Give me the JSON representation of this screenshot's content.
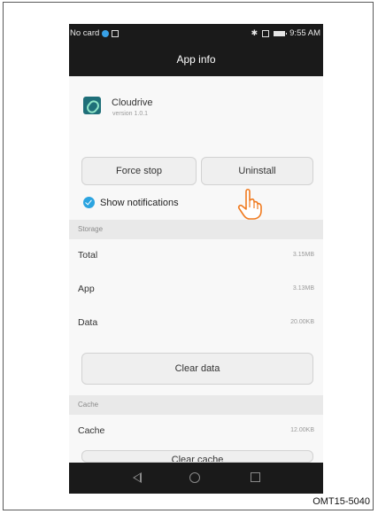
{
  "status_bar": {
    "carrier": "No card",
    "time": "9:55 AM"
  },
  "app_bar": {
    "title": "App info"
  },
  "app": {
    "name": "Cloudrive",
    "version": "version 1.0.1"
  },
  "actions": {
    "force_stop": "Force stop",
    "uninstall": "Uninstall"
  },
  "notifications": {
    "label": "Show notifications",
    "checked": true
  },
  "storage": {
    "header": "Storage",
    "rows": [
      {
        "label": "Total",
        "value": "3.15MB"
      },
      {
        "label": "App",
        "value": "3.13MB"
      },
      {
        "label": "Data",
        "value": "20.00KB"
      }
    ],
    "clear_label": "Clear data"
  },
  "cache": {
    "header": "Cache",
    "row": {
      "label": "Cache",
      "value": "12.00KB"
    },
    "clear_label": "Clear cache"
  },
  "caption": "OMT15-5040",
  "colors": {
    "accent": "#2ba4e0",
    "bar": "#1a1a1a"
  },
  "icons": [
    "globe-icon",
    "sim-icon",
    "bluetooth-icon",
    "vibrate-icon",
    "battery-icon",
    "app-icon",
    "pointing-hand-icon",
    "back-icon",
    "home-icon",
    "recents-icon"
  ]
}
